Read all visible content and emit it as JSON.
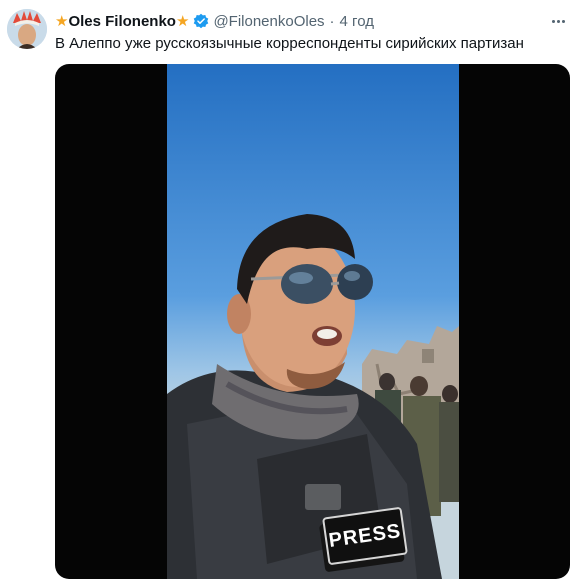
{
  "tweet": {
    "author_name": "Oles Filonenko",
    "star_glyph": "★",
    "handle": "@FilonenkoOles",
    "separator": "·",
    "time": "4 год",
    "text": "В Алеппо уже русскоязычные корреспонденты сирийских партизан",
    "accent_color": "#1d9bf0",
    "star_color": "#f5a623"
  },
  "media": {
    "type": "video",
    "vest_label": "PRESS"
  }
}
